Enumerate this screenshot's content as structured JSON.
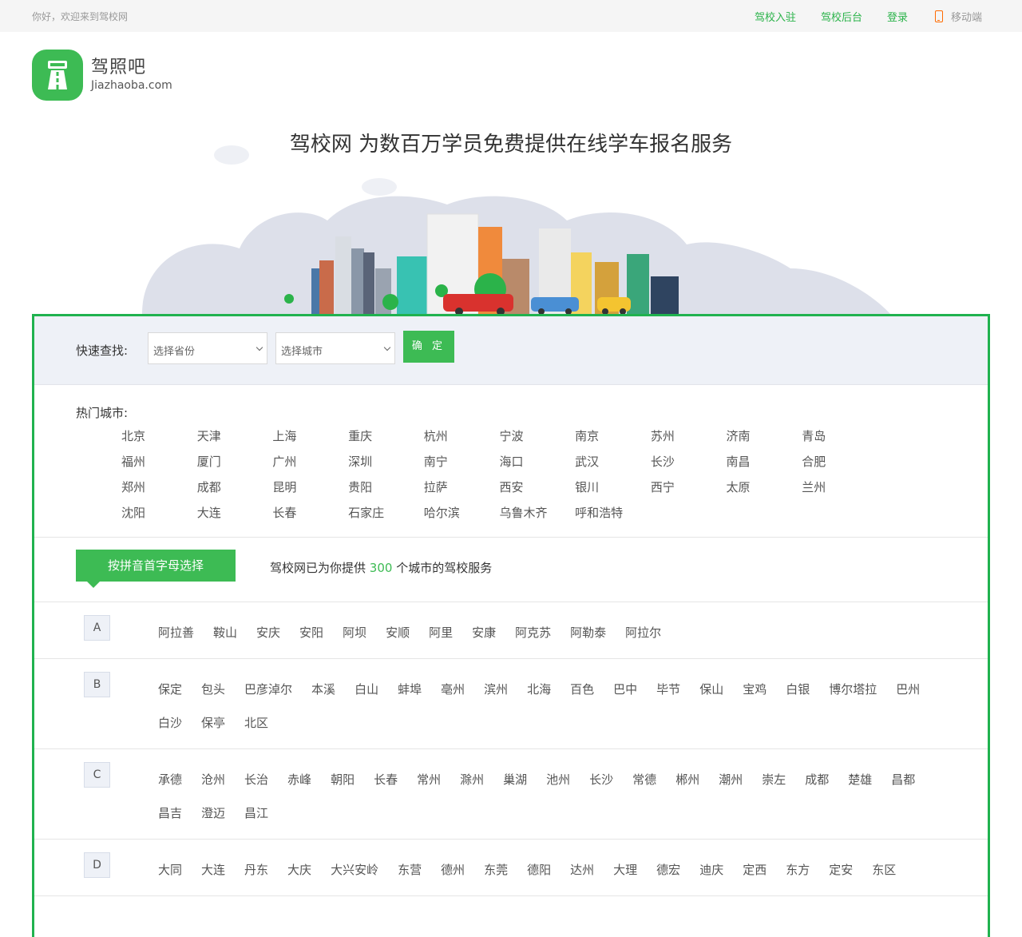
{
  "topbar": {
    "greeting": "你好，欢迎来到驾校网",
    "links": [
      "驾校入驻",
      "驾校后台",
      "登录"
    ],
    "mobile": "移动端"
  },
  "logo": {
    "cn": "驾照吧",
    "en": "Jiazhaoba.com"
  },
  "hero": {
    "title": "驾校网 为数百万学员免费提供在线学车报名服务"
  },
  "search": {
    "label": "快速查找:",
    "province_placeholder": "选择省份",
    "city_placeholder": "选择城市",
    "confirm": "确 定"
  },
  "hot": {
    "label": "热门城市:",
    "cities": [
      "北京",
      "天津",
      "上海",
      "重庆",
      "杭州",
      "宁波",
      "南京",
      "苏州",
      "济南",
      "青岛",
      "福州",
      "厦门",
      "广州",
      "深圳",
      "南宁",
      "海口",
      "武汉",
      "长沙",
      "南昌",
      "合肥",
      "郑州",
      "成都",
      "昆明",
      "贵阳",
      "拉萨",
      "西安",
      "银川",
      "西宁",
      "太原",
      "兰州",
      "沈阳",
      "大连",
      "长春",
      "石家庄",
      "哈尔滨",
      "乌鲁木齐",
      "呼和浩特"
    ]
  },
  "pinyin": {
    "tab": "按拼音首字母选择",
    "info_prefix": "驾校网已为你提供",
    "count": "300",
    "info_suffix": "个城市的驾校服务"
  },
  "letters": [
    {
      "letter": "A",
      "cities": [
        "阿拉善",
        "鞍山",
        "安庆",
        "安阳",
        "阿坝",
        "安顺",
        "阿里",
        "安康",
        "阿克苏",
        "阿勒泰",
        "阿拉尔"
      ]
    },
    {
      "letter": "B",
      "cities": [
        "保定",
        "包头",
        "巴彦淖尔",
        "本溪",
        "白山",
        "蚌埠",
        "亳州",
        "滨州",
        "北海",
        "百色",
        "巴中",
        "毕节",
        "保山",
        "宝鸡",
        "白银",
        "博尔塔拉",
        "巴州",
        "白沙",
        "保亭",
        "北区"
      ]
    },
    {
      "letter": "C",
      "cities": [
        "承德",
        "沧州",
        "长治",
        "赤峰",
        "朝阳",
        "长春",
        "常州",
        "滁州",
        "巢湖",
        "池州",
        "长沙",
        "常德",
        "郴州",
        "潮州",
        "崇左",
        "成都",
        "楚雄",
        "昌都",
        "昌吉",
        "澄迈",
        "昌江"
      ]
    },
    {
      "letter": "D",
      "cities": [
        "大同",
        "大连",
        "丹东",
        "大庆",
        "大兴安岭",
        "东营",
        "德州",
        "东莞",
        "德阳",
        "达州",
        "大理",
        "德宏",
        "迪庆",
        "定西",
        "东方",
        "定安",
        "东区"
      ]
    }
  ],
  "colors": {
    "brand": "#3dbb54",
    "border": "#20b24f"
  }
}
